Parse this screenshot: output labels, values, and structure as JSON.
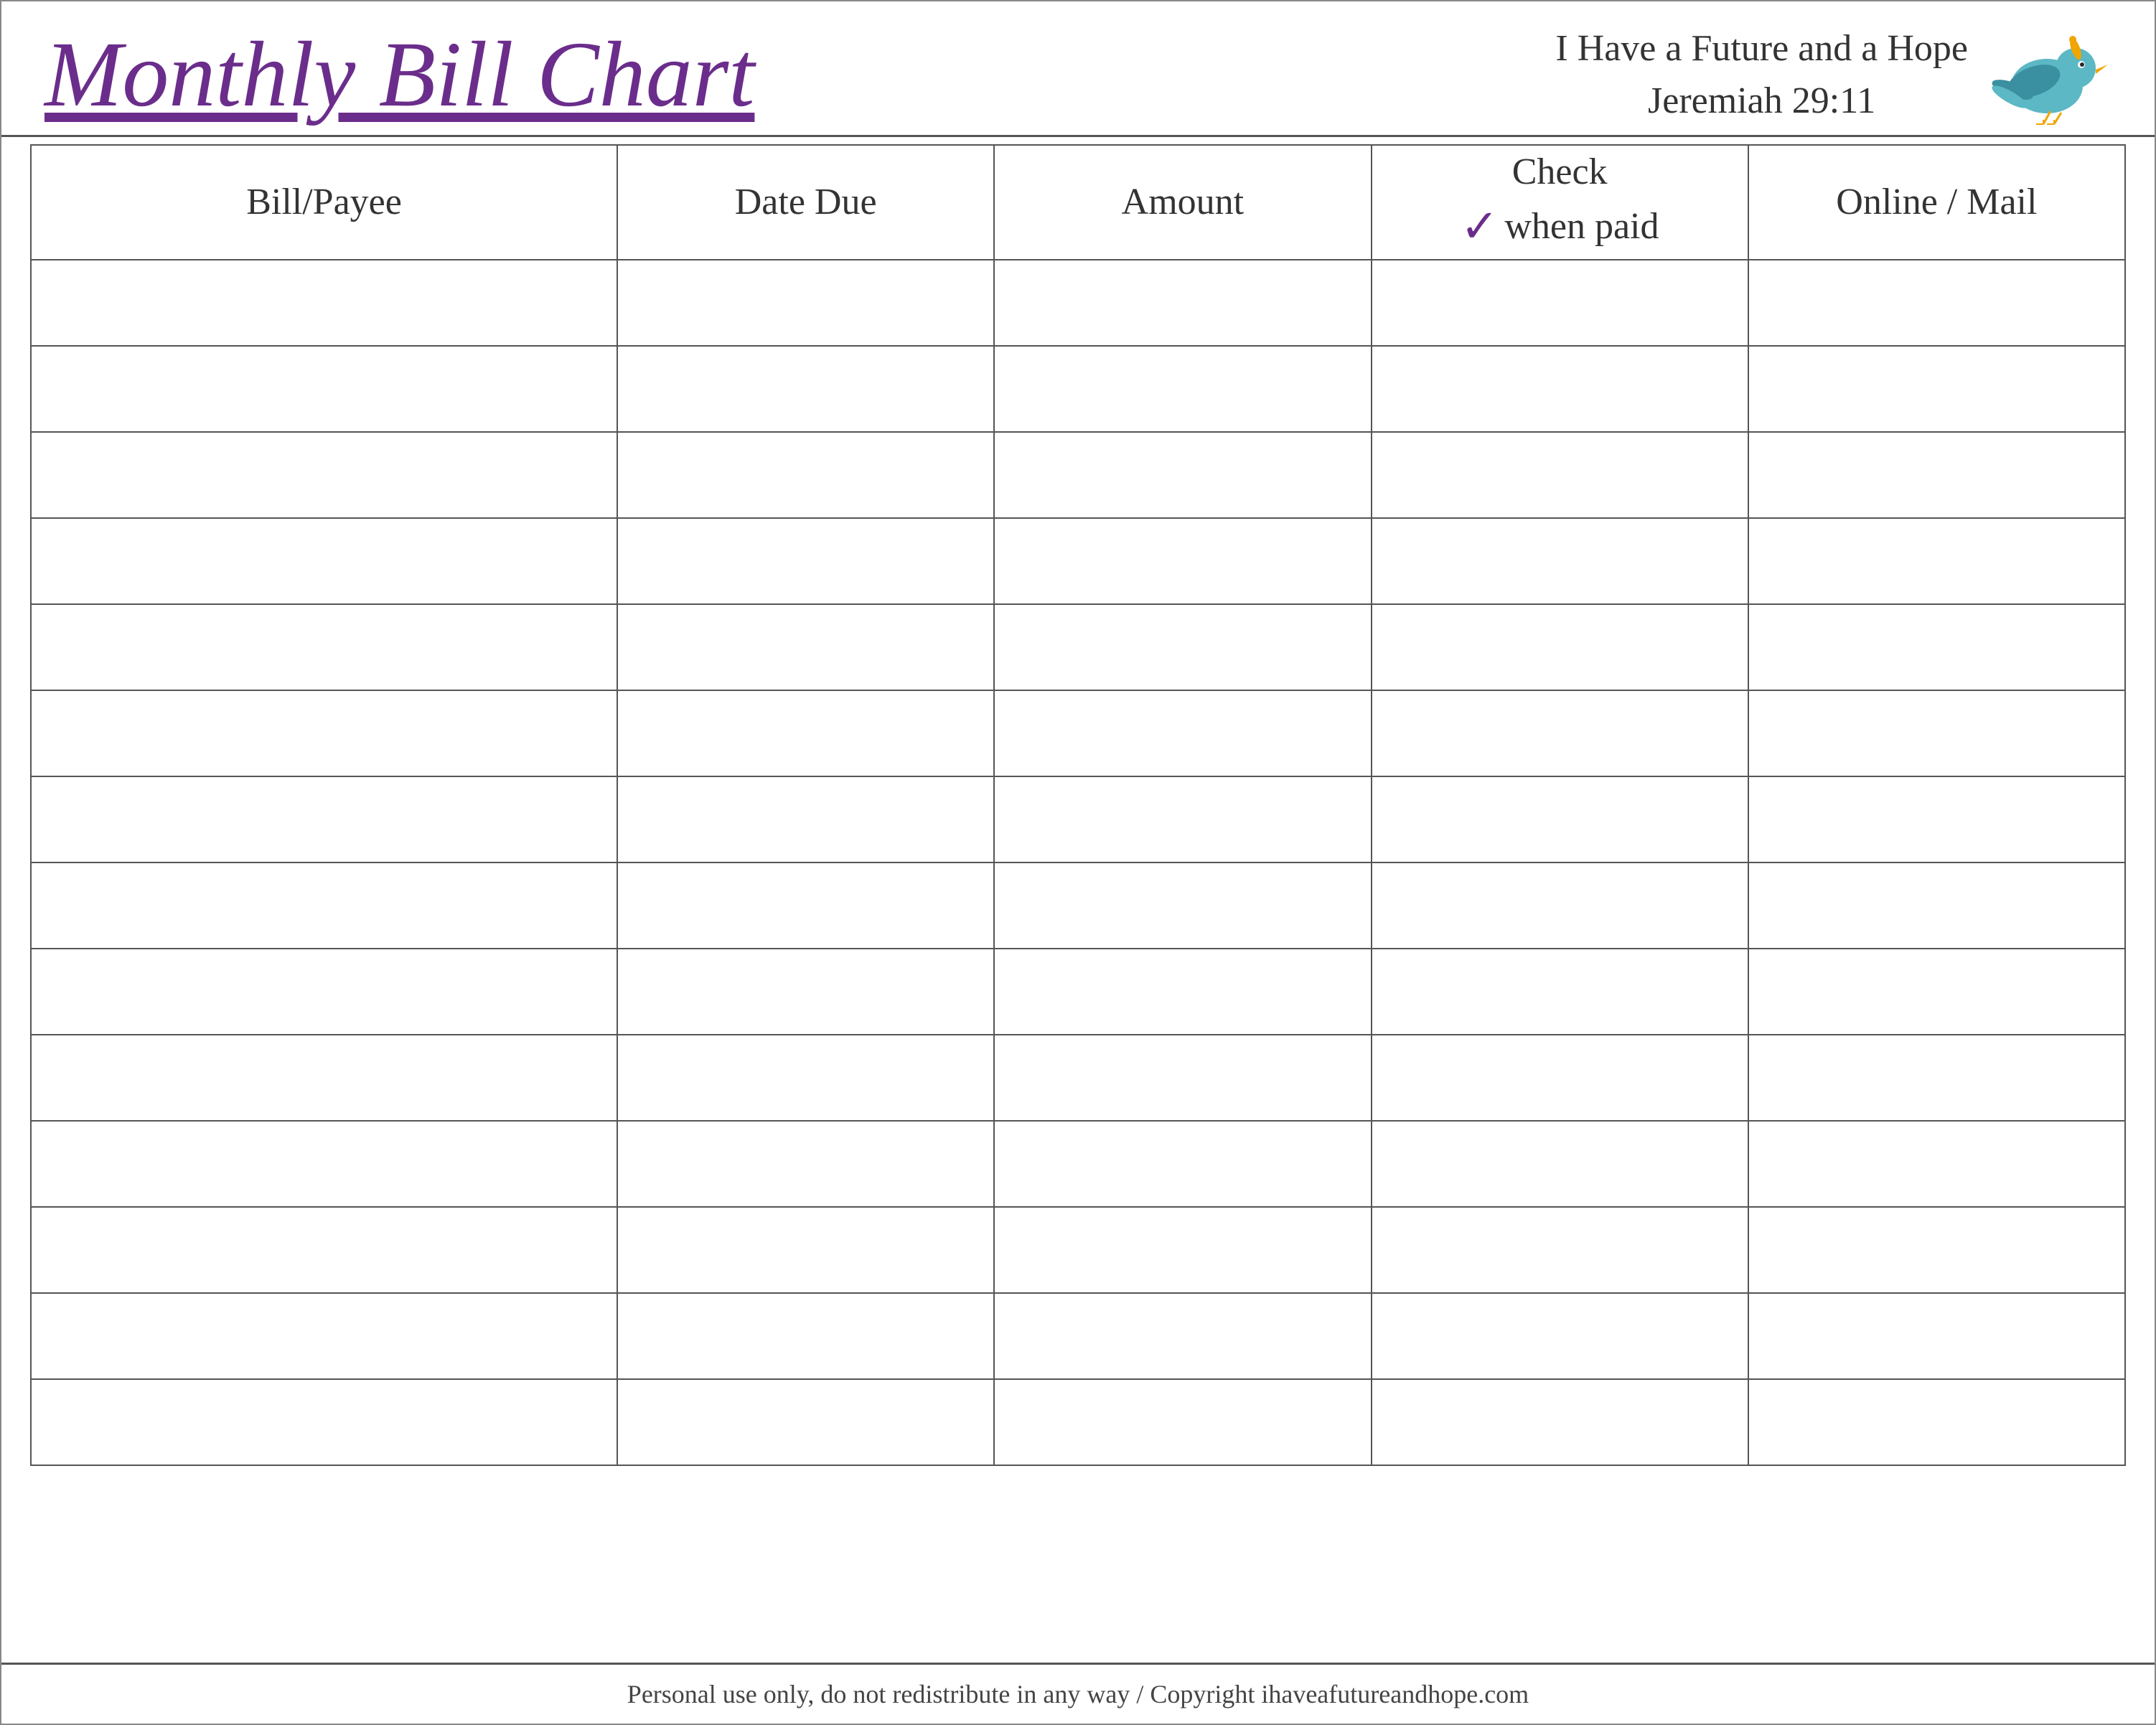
{
  "header": {
    "title": "Monthly Bill Chart",
    "tagline_line1": "I Have a Future and a Hope",
    "tagline_line2": "Jeremiah 29:11"
  },
  "table": {
    "columns": [
      {
        "id": "bill",
        "label": "Bill/Payee"
      },
      {
        "id": "date",
        "label": "Date Due"
      },
      {
        "id": "amount",
        "label": "Amount"
      },
      {
        "id": "check",
        "label_top": "Check",
        "label_bottom": "when paid",
        "has_checkmark": true
      },
      {
        "id": "online",
        "label": "Online / Mail"
      }
    ],
    "row_count": 14
  },
  "footer": {
    "text": "Personal use only, do not redistribute in any way / Copyright ihaveafutureandhope.com"
  },
  "colors": {
    "title": "#6b2d8b",
    "border": "#555555",
    "text": "#333333",
    "checkmark": "#6b2d8b",
    "bird_body": "#5bb8c4",
    "bird_wing": "#3a8fa0",
    "bird_beak": "#f0a500",
    "bird_eye": "#2a2a2a"
  }
}
